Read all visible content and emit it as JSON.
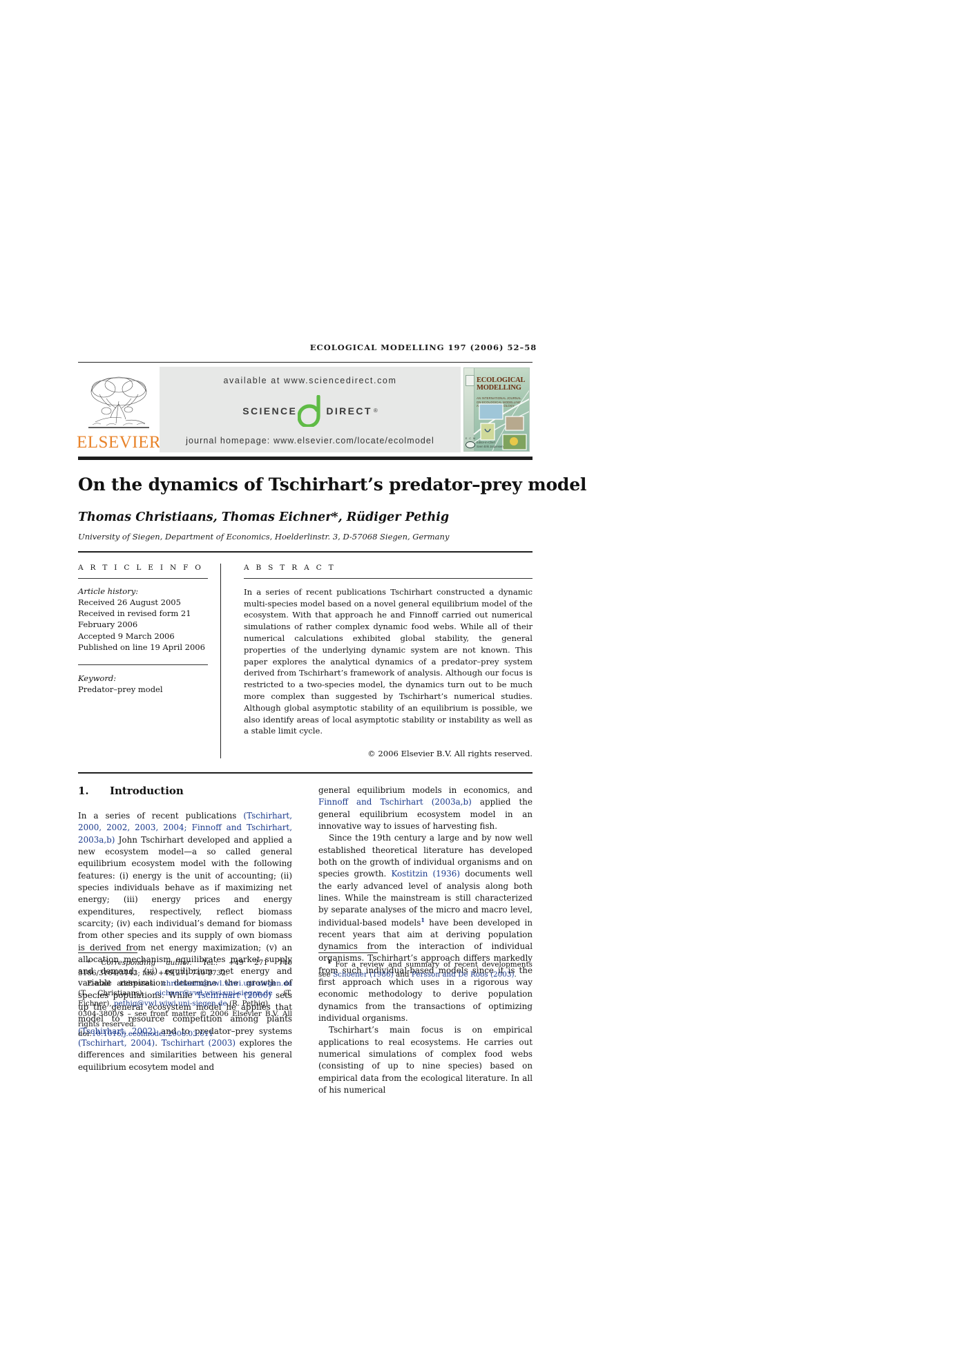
{
  "running_head": "ECOLOGICAL MODELLING  197 (2006) 52–58",
  "banner": {
    "publisher_logo_text": "ELSEVIER",
    "available_at": "available at www.sciencedirect.com",
    "sciencedirect_left": "SCIENCE",
    "sciencedirect_right": "DIRECT",
    "sciencedirect_reg": "®",
    "journal_homepage": "journal homepage: www.elsevier.com/locate/ecolmodel",
    "cover": {
      "title_line1": "ECOLOGICAL",
      "title_line2": "MODELLING",
      "subtitle": "AN INTERNATIONAL JOURNAL ON ECOLOGICAL MODELLING AND SYSTEMS ECOLOGY",
      "footer_line1": "Editor-in-Chief",
      "footer_line2": "Sven Erik Jorgensen",
      "society_mark": "E  C  M"
    }
  },
  "article": {
    "title": "On the dynamics of Tschirhart’s predator–prey model",
    "authors": "Thomas Christiaans, Thomas Eichner*, Rüdiger Pethig",
    "affiliation": "University of Siegen, Department of Economics, Hoelderlinstr. 3, D-57068 Siegen, Germany"
  },
  "article_info": {
    "label": "A R T I C L E   I N F O",
    "history_head": "Article history:",
    "history_lines": [
      "Received 26 August 2005",
      "Received in revised form 21",
      "February 2006",
      "Accepted 9 March 2006",
      "Published on line 19 April 2006"
    ],
    "keyword_head": "Keyword:",
    "keywords": "Predator–prey model"
  },
  "abstract": {
    "label": "A B S T R A C T",
    "text": "In a series of recent publications Tschirhart constructed a dynamic multi-species model based on a novel general equilibrium model of the ecosystem. With that approach he and Finnoff carried out numerical simulations of rather complex dynamic food webs. While all of their numerical calculations exhibited global stability, the general properties of the underlying dynamic system are not known. This paper explores the analytical dynamics of a predator–prey system derived from Tschirhart’s framework of analysis. Although our focus is restricted to a two-species model, the dynamics turn out to be much more complex than suggested by Tschirhart’s numerical studies. Although global asymptotic stability of an equilibrium is possible, we also identify areas of local asymptotic stability or instability as well as a stable limit cycle.",
    "copyright": "© 2006 Elsevier B.V. All rights reserved."
  },
  "body": {
    "section_number": "1.",
    "section_title": "Introduction",
    "left_paragraph_1_a": "In a series of recent publications ",
    "left_paragraph_1_ref1": "(Tschirhart, 2000, 2002, 2003, 2004; Finnoff and Tschirhart, 2003a,b)",
    "left_paragraph_1_b": " John Tschirhart developed and applied a new ecosystem model—a so called general equilibrium ecosystem model with the following features: (i) energy is the unit of accounting; (ii) species individuals behave as if maximizing net energy; (iii) energy prices and energy expenditures, respectively, reflect biomass scarcity; (iv) each individual’s demand for biomass from other species and its supply of own biomass is derived from net energy maximization; (v) an allocation mechanism equilibrates market supply and demand; (vi) equilibrium net energy and variable respiration determine the growth of species populations. While ",
    "left_paragraph_1_ref2": "Tschirhart (2000)",
    "left_paragraph_1_c": " sets up the general ecosystem model he applies that model to resource competition among plants ",
    "left_paragraph_1_ref3": "(Tschirhart, 2002)",
    "left_paragraph_1_d": " and to predator–prey systems ",
    "left_paragraph_1_ref4": "(Tschirhart, 2004)",
    "left_paragraph_1_e": ". ",
    "left_paragraph_1_ref5": "Tschirhart (2003)",
    "left_paragraph_1_f": " explores the differences and similarities between his general equilibrium ecosytem model and",
    "right_paragraph_1_a": "general equilibrium models in economics, and ",
    "right_paragraph_1_ref1": "Finnoff and Tschirhart (2003a,b)",
    "right_paragraph_1_b": " applied the general equilibrium ecosystem model in an innovative way to issues of harvesting fish.",
    "right_paragraph_2_a": "Since the 19th century a large and by now well established theoretical literature has developed both on the growth of individual organisms and on species growth. ",
    "right_paragraph_2_ref1": "Kostitzin (1936)",
    "right_paragraph_2_b": " documents well the early advanced level of analysis along both lines. While the mainstream is still characterized by separate analyses of the micro and macro level, individual-based models",
    "right_paragraph_2_fn": "1",
    "right_paragraph_2_c": " have been developed in recent years that aim at deriving population dynamics from the interaction of individual organisms. Tschirhart’s approach differs markedly from such individual-based models since it is the first approach which uses in a rigorous way economic methodology to derive population dynamics from the transactions of optimizing individual organisms.",
    "right_paragraph_3": "Tschirhart’s main focus is on empirical applications to real ecosystems. He carries out numerical simulations of complex food webs (consisting of up to nine species) based on empirical data from the ecological literature. In all of his numerical"
  },
  "footnotes": {
    "corresponding_marker": "*",
    "corresponding_label": "Corresponding author.",
    "corresponding_tel": " Tel.: +49 271 740 3186/3164/3143;",
    "corresponding_fax": "fax: +49 271 740 2732.",
    "email_label": "E-mail addresses: ",
    "email_1": "christiaans@vwl.wiwi.uni-siegen.de",
    "email_1_name": " (T. Christiaans), ",
    "email_2": "eichner@vwl.wiwi.uni-siegen.de",
    "email_2_name": " (T. Eichner), ",
    "email_3": "pethig@vwl.wiwi.uni-siegen.de",
    "email_3_name": " (R. Pethig).",
    "front_matter": "0304-3800/$ – see front matter © 2006 Elsevier B.V. All rights reserved.",
    "doi_label": "doi:",
    "doi_value": "10.1016/j.ecolmodel.2006.03.011",
    "fn1_marker": "1",
    "fn1_text_a": " For a review and summary of recent developments see ",
    "fn1_ref1": "Schoener (1986)",
    "fn1_text_b": " and ",
    "fn1_ref2": "Persson and De Roos (2003)",
    "fn1_text_c": "."
  },
  "colors": {
    "elsevier_orange": "#e8832a",
    "sciencedirect_green": "#5fbb46",
    "link_blue": "#1b3a8c",
    "banner_grey": "#e7e8e7"
  }
}
